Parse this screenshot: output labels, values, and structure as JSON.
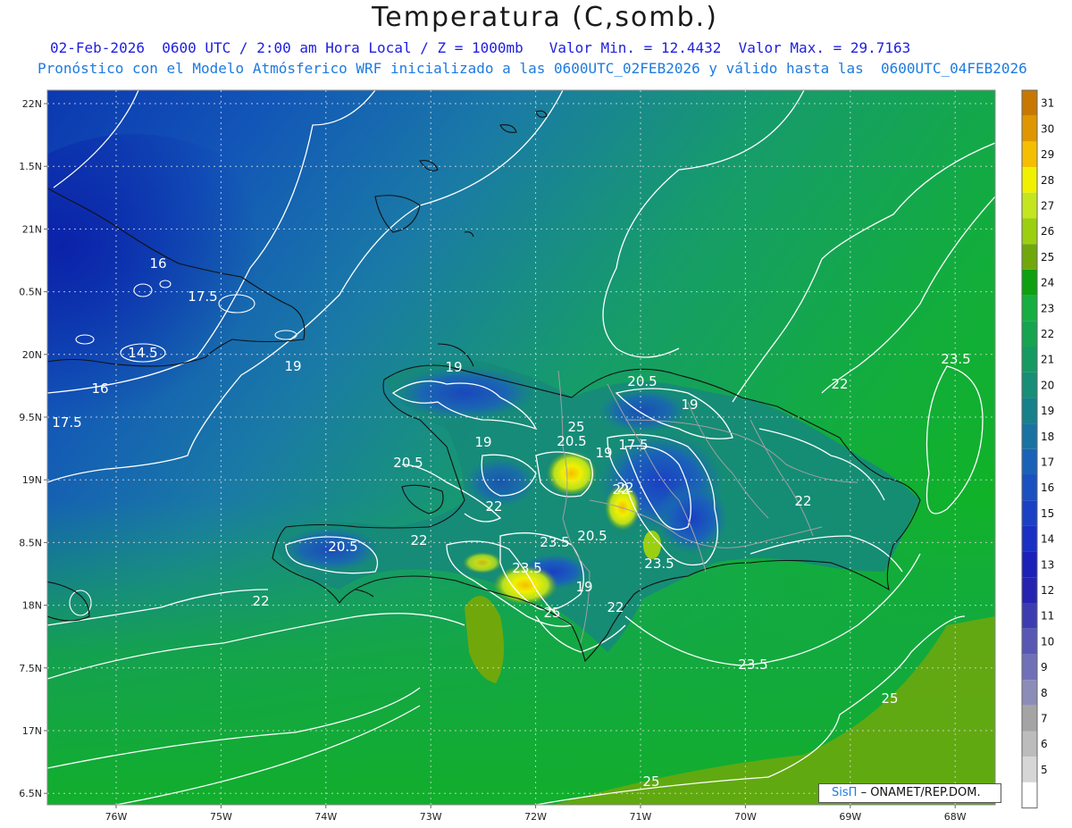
{
  "header": {
    "title": "Temperatura (C,somb.)",
    "line1": "02-Feb-2026  0600 UTC / 2:00 am Hora Local / Z = 1000mb   Valor Min. = 12.4432  Valor Max. = 29.7163",
    "line2": "Pronóstico con el Modelo Atmósferico WRF inicializado a las 0600UTC_02FEB2026 y válido hasta las  0600UTC_04FEB2026"
  },
  "map": {
    "lat_ticks": [
      "22N",
      "1.5N",
      "21N",
      "0.5N",
      "20N",
      "9.5N",
      "19N",
      "8.5N",
      "18N",
      "7.5N",
      "17N",
      "6.5N"
    ],
    "lon_ticks": [
      "76W",
      "75W",
      "74W",
      "73W",
      "72W",
      "71W",
      "70W",
      "69W",
      "68W"
    ],
    "contour_labels": [
      "16",
      "17.5",
      "14.5",
      "16",
      "17.5",
      "19",
      "19",
      "19",
      "20.5",
      "20.5",
      "19",
      "17.5",
      "19",
      "20.5",
      "22",
      "22",
      "22",
      "20.5",
      "22",
      "22",
      "23.5",
      "23.5",
      "20.5",
      "25",
      "23.5",
      "19",
      "22",
      "25",
      "23.5",
      "23.5",
      "25",
      "25",
      "22",
      "22"
    ],
    "colors": {
      "ocean_deep": "#0c3fb5",
      "ocean_mid": "#1470b8",
      "sea_green": "#12a35f",
      "warm_green": "#18b030",
      "land_yellow": "#e8e800"
    }
  },
  "colorbar": {
    "labels": [
      "31",
      "30",
      "29",
      "28",
      "27",
      "26",
      "25",
      "24",
      "23",
      "22",
      "21",
      "20",
      "19",
      "18",
      "17",
      "16",
      "15",
      "14",
      "13",
      "12",
      "11",
      "10",
      "9",
      "8",
      "7",
      "6",
      "5"
    ],
    "colors": [
      "#c87800",
      "#e09600",
      "#f5be00",
      "#f0f000",
      "#c4e620",
      "#9ad010",
      "#70a80c",
      "#0ea010",
      "#16ae40",
      "#16a450",
      "#169a62",
      "#178e76",
      "#18808a",
      "#1a72a2",
      "#1a62b8",
      "#1a50c0",
      "#1a40c4",
      "#1a30c4",
      "#1a20b8",
      "#2424b0",
      "#3c3cb0",
      "#5858b4",
      "#7070b8",
      "#8c8cb8",
      "#a4a4a4",
      "#bcbcbc",
      "#d6d6d6",
      "#ffffff"
    ]
  },
  "credit": {
    "brand": "SisΠ",
    "text": "– ONAMET/REP.DOM."
  }
}
